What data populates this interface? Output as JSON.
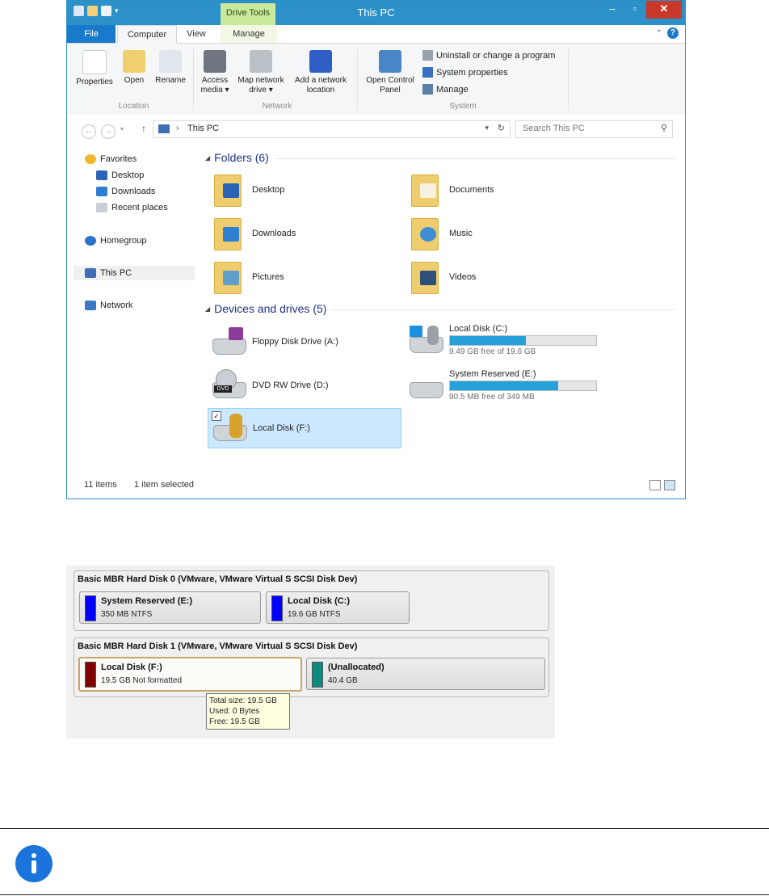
{
  "window": {
    "title": "This PC",
    "context_tab": "Drive Tools",
    "minimize": "–",
    "maximize": "▫",
    "close": "✕"
  },
  "ribbon_tabs": [
    "File",
    "Computer",
    "View",
    "Manage"
  ],
  "ribbon": {
    "location": {
      "label": "Location",
      "buttons": [
        "Properties",
        "Open",
        "Rename"
      ]
    },
    "network": {
      "label": "Network",
      "access_media": [
        "Access",
        "media ▾"
      ],
      "map_drive": [
        "Map network",
        "drive ▾"
      ],
      "add_location": [
        "Add a network",
        "location"
      ]
    },
    "system": {
      "label": "System",
      "control_panel": [
        "Open Control",
        "Panel"
      ],
      "links": [
        "Uninstall or change a program",
        "System properties",
        "Manage"
      ]
    }
  },
  "address": {
    "path": "This PC",
    "search_placeholder": "Search This PC"
  },
  "nav": {
    "favorites": "Favorites",
    "desktop": "Desktop",
    "downloads": "Downloads",
    "recent": "Recent places",
    "homegroup": "Homegroup",
    "this_pc": "This PC",
    "network": "Network"
  },
  "folders": {
    "header": "Folders (6)",
    "items": [
      "Desktop",
      "Documents",
      "Downloads",
      "Music",
      "Pictures",
      "Videos"
    ]
  },
  "devices": {
    "header": "Devices and drives (5)",
    "floppy": "Floppy Disk Drive (A:)",
    "dvd": "DVD RW Drive (D:)",
    "local_f": "Local Disk (F:)",
    "local_c": {
      "name": "Local Disk (C:)",
      "free": "9.49 GB free of 19.6 GB",
      "used_fraction": 0.52
    },
    "system_reserved": {
      "name": "System Reserved (E:)",
      "free": "90.5 MB free of 349 MB",
      "used_fraction": 0.74
    }
  },
  "status": {
    "items": "11 items",
    "selected": "1 item selected"
  },
  "disk_map": {
    "disk0": {
      "title": "Basic MBR Hard Disk 0 (VMware, VMware Virtual S SCSI Disk Dev)",
      "p1": {
        "name": "System Reserved (E:)",
        "info": "350 MB NTFS",
        "color": "#0000ff"
      },
      "p2": {
        "name": "Local Disk (C:)",
        "info": "19.6 GB NTFS",
        "color": "#0000ff"
      }
    },
    "disk1": {
      "title": "Basic MBR Hard Disk 1 (VMware, VMware Virtual S SCSI Disk Dev)",
      "p1": {
        "name": "Local Disk (F:)",
        "info": "19.5 GB Not formatted",
        "color": "#800000"
      },
      "p2": {
        "name": "(Unallocated)",
        "info": "40.4 GB",
        "color": "#0e8a80"
      }
    },
    "tooltip": [
      "Total size: 19.5 GB",
      "Used: 0 Bytes",
      "Free: 19.5 GB"
    ]
  }
}
